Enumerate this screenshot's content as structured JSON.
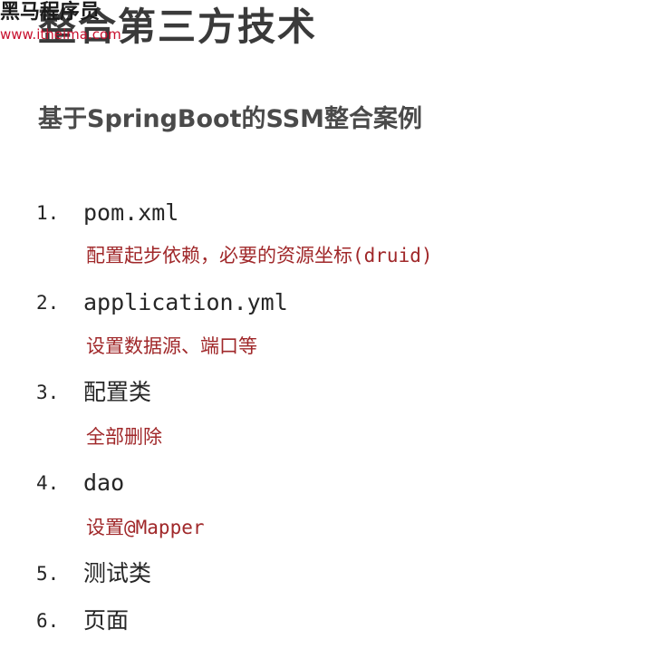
{
  "watermark": {
    "name": "黑马程序员",
    "url": "www.itheima.com"
  },
  "title": "整合第三方技术",
  "subtitle": "基于SpringBoot的SSM整合案例",
  "items": [
    {
      "number": "1.",
      "label": "pom.xml",
      "note": "配置起步依赖，必要的资源坐标(druid)"
    },
    {
      "number": "2.",
      "label": "application.yml",
      "note": "设置数据源、端口等"
    },
    {
      "number": "3.",
      "label": "配置类",
      "note": "全部删除"
    },
    {
      "number": "4.",
      "label": "dao",
      "note": "设置@Mapper"
    },
    {
      "number": "5.",
      "label": "测试类"
    },
    {
      "number": "6.",
      "label": "页面"
    }
  ]
}
